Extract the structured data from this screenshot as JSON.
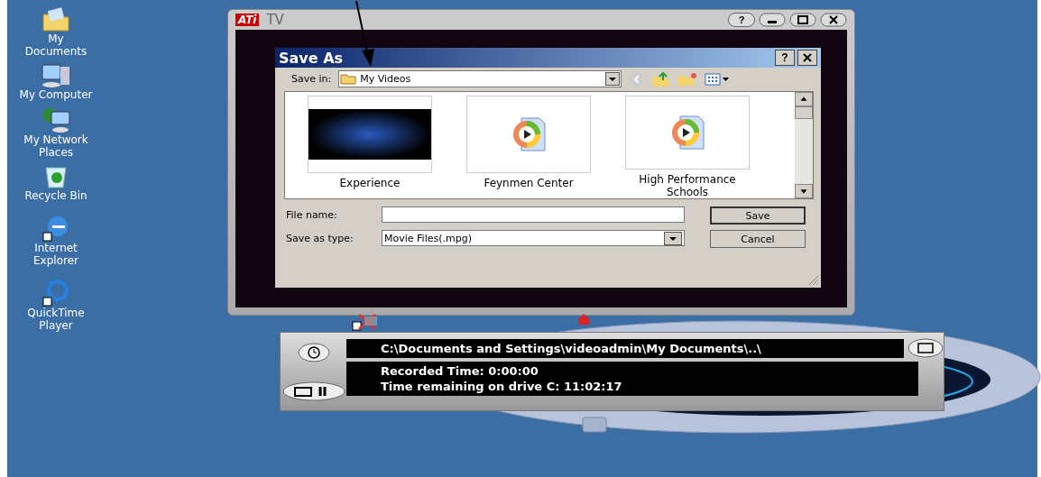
{
  "desktop_icons": [
    {
      "kind": "documents",
      "label": "My\nDocuments"
    },
    {
      "kind": "computer",
      "label": "My Computer"
    },
    {
      "kind": "network",
      "label": "My Network\nPlaces"
    },
    {
      "kind": "recycle",
      "label": "Recycle Bin"
    },
    {
      "kind": "browser",
      "label": "Internet\nExplorer"
    },
    {
      "kind": "player",
      "label": "QuickTime\nPlayer"
    }
  ],
  "tv_window": {
    "logo": "ATi",
    "title": "TV",
    "help": "?"
  },
  "save_dialog": {
    "title": "Save As",
    "help": "?",
    "save_in_label": "Save in:",
    "save_in_value": "My Videos",
    "files": [
      {
        "kind": "video",
        "name": "Experience"
      },
      {
        "kind": "media",
        "name": "Feynmen Center"
      },
      {
        "kind": "media",
        "name": "High Performance Schools"
      }
    ],
    "file_name_label": "File name:",
    "type_label": "Save as type:",
    "type_value": "Movie Files(.mpg)",
    "buttons": [
      "Save",
      "Cancel"
    ]
  },
  "recorder": {
    "path": "C:\\Documents and Settings\\videoadmin\\My Documents\\..\\",
    "recorded": "Recorded Time:  0:00:00",
    "remaining": "Time remaining on drive C: 11:02:17"
  }
}
